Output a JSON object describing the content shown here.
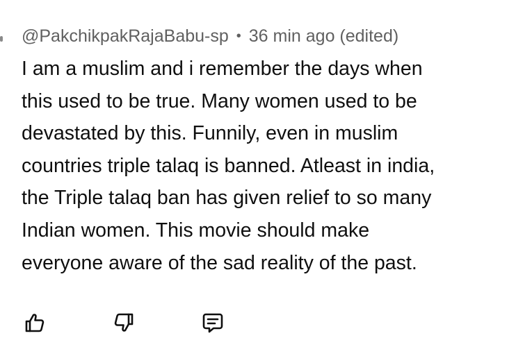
{
  "comment": {
    "author": "@PakchikpakRajaBabu-sp",
    "separator": "•",
    "timestamp": "36 min ago (edited)",
    "text": "I am a muslim and i remember the days when\nthis used to be true. Many women used to be\ndevastated by this. Funnily, even in muslim\ncountries triple talaq is banned. Atleast in india,\nthe Triple talaq ban has given relief to so many\nIndian women. This movie should make\neveryone aware of the sad reality of the past."
  },
  "actions": {
    "like_icon": "thumbs-up-icon",
    "dislike_icon": "thumbs-down-icon",
    "reply_icon": "comment-icon"
  },
  "colors": {
    "text": "#0f0f0f",
    "meta": "#606060",
    "background": "#ffffff"
  }
}
